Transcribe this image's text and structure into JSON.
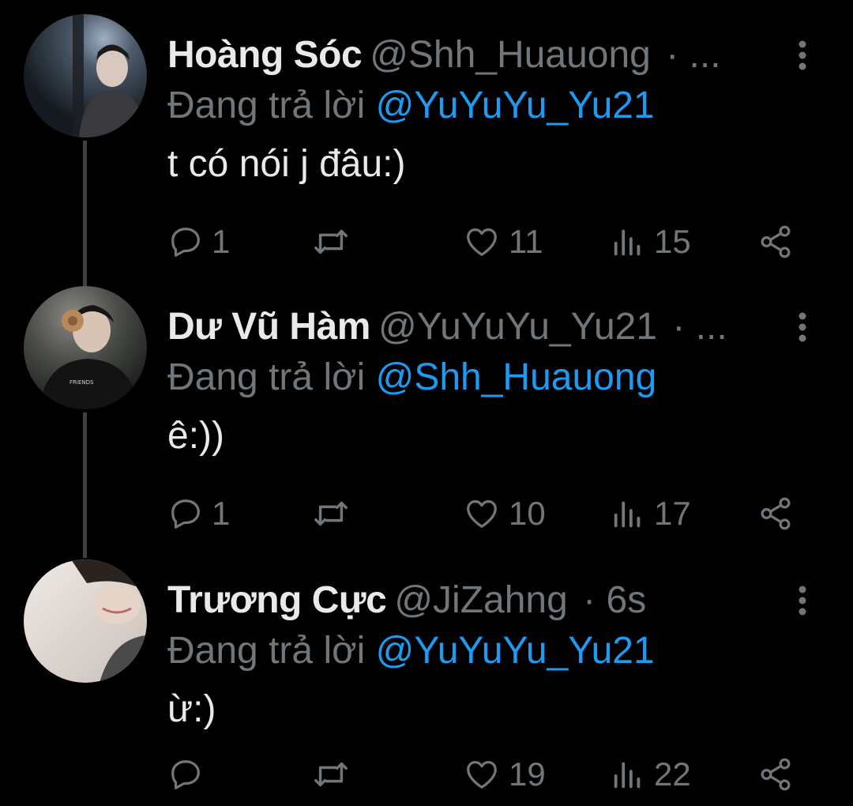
{
  "colors": {
    "background": "#000000",
    "name": "#e7e9ea",
    "secondary": "#71767b",
    "link": "#1d9bf0",
    "thread_line": "#3e4144"
  },
  "icons": {
    "reply": "reply-icon",
    "retweet": "retweet-icon",
    "like": "heart-icon",
    "views": "views-icon",
    "share": "share-icon",
    "more": "more-vertical-icon"
  },
  "tweets": [
    {
      "name": "Hoàng Sóc",
      "handle": "@Shh_Huauong",
      "meta": "· ...",
      "replying_prefix": "Đang trả lời",
      "replying_to": "@YuYuYu_Yu21",
      "text": "t có nói j đâu:)",
      "replies": "1",
      "retweets": "",
      "likes": "11",
      "views": "15"
    },
    {
      "name": "Dư Vũ Hàm",
      "handle": "@YuYuYu_Yu21",
      "meta": "· ...",
      "replying_prefix": "Đang trả lời",
      "replying_to": "@Shh_Huauong",
      "text": "ê:))",
      "replies": "1",
      "retweets": "",
      "likes": "10",
      "views": "17"
    },
    {
      "name": "Trương Cực",
      "handle": "@JiZahng",
      "meta": "· 6s",
      "replying_prefix": "Đang trả lời",
      "replying_to": "@YuYuYu_Yu21",
      "text": "ừ:)",
      "replies": "",
      "retweets": "",
      "likes": "19",
      "views": "22"
    }
  ]
}
